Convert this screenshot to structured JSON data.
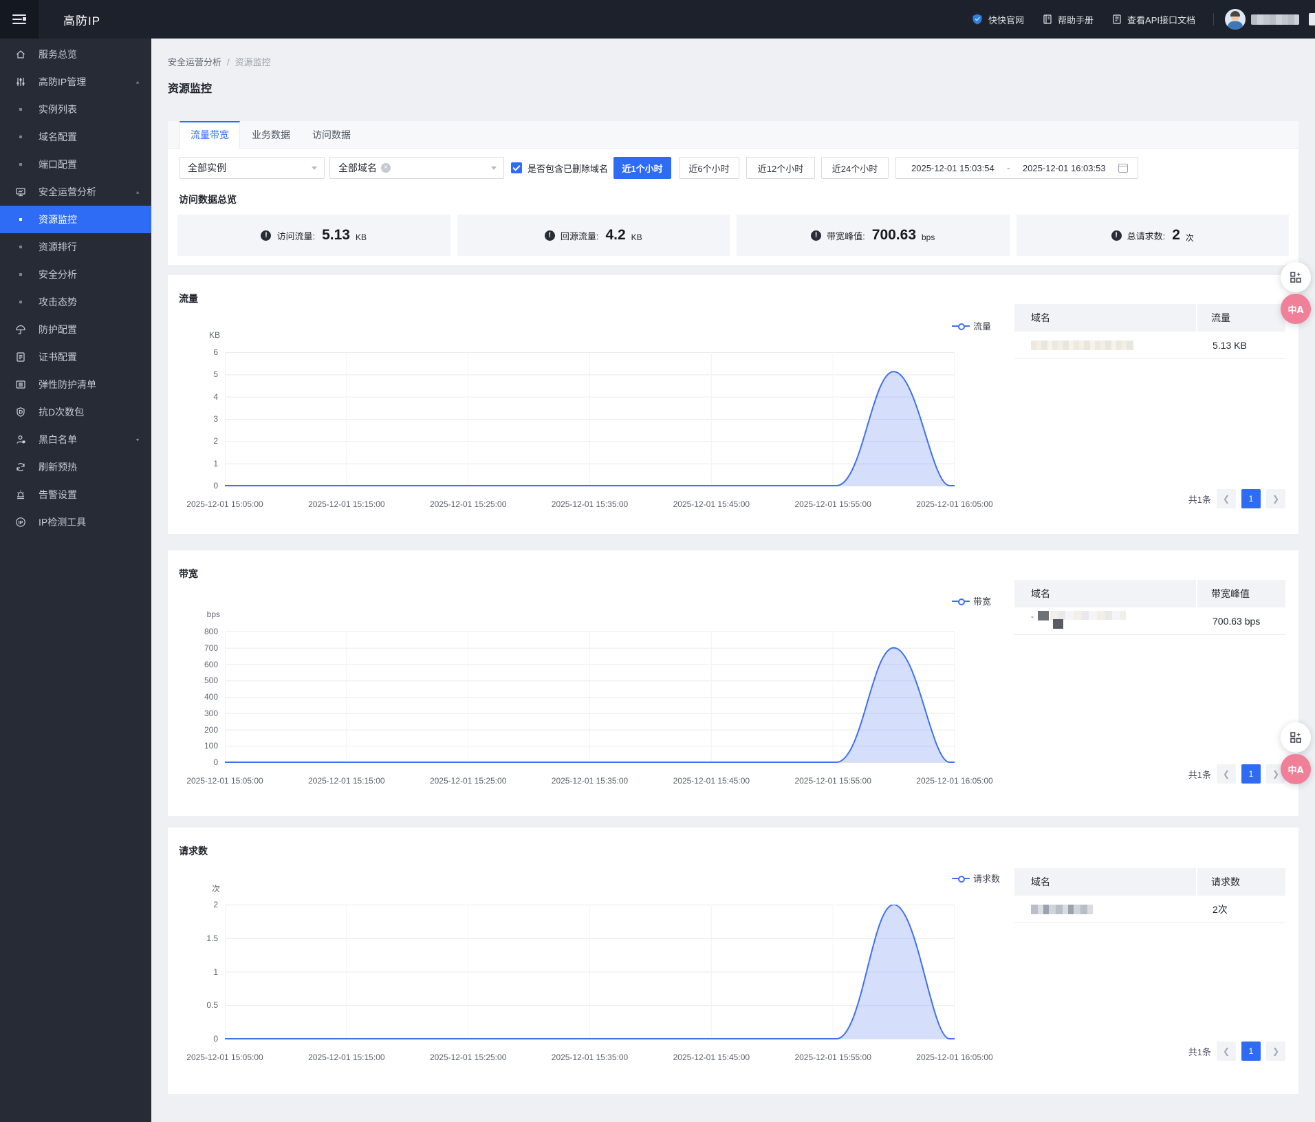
{
  "header": {
    "title": "高防IP",
    "nav": [
      {
        "key": "official-site",
        "label": "快快官网",
        "icon": "shield-logo"
      },
      {
        "key": "help-manual",
        "label": "帮助手册",
        "icon": "book"
      },
      {
        "key": "api-doc",
        "label": "查看API接口文档",
        "icon": "api-doc"
      }
    ],
    "user_name_redacted": true
  },
  "sidebar": {
    "items": [
      {
        "key": "service-overview",
        "label": "服务总览",
        "type": "top",
        "icon": "home"
      },
      {
        "key": "ip-manage",
        "label": "高防IP管理",
        "type": "top",
        "icon": "sliders",
        "arrow": "up"
      },
      {
        "key": "instance-list",
        "label": "实例列表",
        "type": "sub"
      },
      {
        "key": "domain-config",
        "label": "域名配置",
        "type": "sub"
      },
      {
        "key": "port-config",
        "label": "端口配置",
        "type": "sub"
      },
      {
        "key": "security-analysis-group",
        "label": "安全运营分析",
        "type": "top",
        "icon": "monitor",
        "arrow": "up"
      },
      {
        "key": "resource-monitor",
        "label": "资源监控",
        "type": "sub",
        "active": true
      },
      {
        "key": "resource-rank",
        "label": "资源排行",
        "type": "sub"
      },
      {
        "key": "security-analysis",
        "label": "安全分析",
        "type": "sub"
      },
      {
        "key": "attack-trend",
        "label": "攻击态势",
        "type": "sub"
      },
      {
        "key": "protect-config",
        "label": "防护配置",
        "type": "top",
        "icon": "umbrella"
      },
      {
        "key": "cert-config",
        "label": "证书配置",
        "type": "top",
        "icon": "cert"
      },
      {
        "key": "elastic-protect-list",
        "label": "弹性防护清单",
        "type": "top",
        "icon": "list"
      },
      {
        "key": "antid-package",
        "label": "抗D次数包",
        "type": "top",
        "icon": "shield"
      },
      {
        "key": "black-white-list",
        "label": "黑白名单",
        "type": "top",
        "icon": "person",
        "arrow": "down"
      },
      {
        "key": "refresh-preheat",
        "label": "刷新预热",
        "type": "top",
        "icon": "refresh"
      },
      {
        "key": "alert-setting",
        "label": "告警设置",
        "type": "top",
        "icon": "alarm"
      },
      {
        "key": "ip-check-tool",
        "label": "IP检测工具",
        "type": "top",
        "icon": "ip"
      }
    ]
  },
  "breadcrumb": {
    "parent": "安全运营分析",
    "separator": "/",
    "current": "资源监控"
  },
  "page": {
    "title": "资源监控"
  },
  "tabs": [
    {
      "key": "traffic-bandwidth",
      "label": "流量带宽",
      "active": true
    },
    {
      "key": "business-data",
      "label": "业务数据",
      "active": false
    },
    {
      "key": "access-data",
      "label": "访问数据",
      "active": false
    }
  ],
  "filters": {
    "instance_select": "全部实例",
    "domain_select": "全部域名",
    "checkbox_label": "是否包含已删除域名",
    "checkbox_checked": true,
    "time_buttons": [
      {
        "label": "近1个小时",
        "active": true
      },
      {
        "label": "近6个小时",
        "active": false
      },
      {
        "label": "近12个小时",
        "active": false
      },
      {
        "label": "近24个小时",
        "active": false
      }
    ],
    "date_start": "2025-12-01 15:03:54",
    "date_end": "2025-12-01 16:03:53"
  },
  "overview": {
    "title": "访问数据总览",
    "stats": [
      {
        "label": "访问流量:",
        "value": "5.13",
        "unit": "KB"
      },
      {
        "label": "回源流量:",
        "value": "4.2",
        "unit": "KB"
      },
      {
        "label": "带宽峰值:",
        "value": "700.63",
        "unit": "bps"
      },
      {
        "label": "总请求数:",
        "value": "2",
        "unit": "次"
      }
    ]
  },
  "chart_data": [
    {
      "type": "area",
      "title": "流量",
      "legend": "流量",
      "ylabel_unit": "KB",
      "ylim": [
        0,
        6
      ],
      "yticks": [
        0,
        1,
        2,
        3,
        4,
        5,
        6
      ],
      "x": [
        "15:05",
        "15:10",
        "15:15",
        "15:20",
        "15:25",
        "15:30",
        "15:35",
        "15:40",
        "15:45",
        "15:50",
        "15:55",
        "16:00",
        "16:05"
      ],
      "values": [
        0,
        0,
        0,
        0,
        0,
        0,
        0,
        0,
        0,
        0,
        0,
        5.13,
        0
      ],
      "xtick_labels": [
        "2025-12-01 15:05:00",
        "2025-12-01 15:15:00",
        "2025-12-01 15:25:00",
        "2025-12-01 15:35:00",
        "2025-12-01 15:45:00",
        "2025-12-01 15:55:00",
        "2025-12-01 16:05:00"
      ],
      "grid": true,
      "legend_position": "top-right",
      "table": {
        "domain_header": "域名",
        "value_header": "流量",
        "rows": [
          {
            "domain_redacted": true,
            "value": "5.13 KB"
          }
        ],
        "blur_style": "light"
      },
      "pagination": {
        "total_label": "共1条",
        "page": "1"
      }
    },
    {
      "type": "area",
      "title": "带宽",
      "legend": "带宽",
      "ylabel_unit": "bps",
      "ylim": [
        0,
        800
      ],
      "yticks": [
        0,
        100,
        200,
        300,
        400,
        500,
        600,
        700,
        800
      ],
      "x": [
        "15:05",
        "15:10",
        "15:15",
        "15:20",
        "15:25",
        "15:30",
        "15:35",
        "15:40",
        "15:45",
        "15:50",
        "15:55",
        "16:00",
        "16:05"
      ],
      "values": [
        0,
        0,
        0,
        0,
        0,
        0,
        0,
        0,
        0,
        0,
        0,
        700.63,
        0
      ],
      "xtick_labels": [
        "2025-12-01 15:05:00",
        "2025-12-01 15:15:00",
        "2025-12-01 15:25:00",
        "2025-12-01 15:35:00",
        "2025-12-01 15:45:00",
        "2025-12-01 15:55:00",
        "2025-12-01 16:05:00"
      ],
      "grid": true,
      "legend_position": "top-right",
      "table": {
        "domain_header": "域名",
        "value_header": "带宽峰值",
        "rows": [
          {
            "domain_redacted": true,
            "value": "700.63 bps"
          }
        ],
        "blur_style": "dark"
      },
      "pagination": {
        "total_label": "共1条",
        "page": "1"
      }
    },
    {
      "type": "area",
      "title": "请求数",
      "legend": "请求数",
      "ylabel_unit": "次",
      "ylim": [
        0,
        2
      ],
      "yticks": [
        0,
        0.5,
        1,
        1.5,
        2
      ],
      "x": [
        "15:05",
        "15:10",
        "15:15",
        "15:20",
        "15:25",
        "15:30",
        "15:35",
        "15:40",
        "15:45",
        "15:50",
        "15:55",
        "16:00",
        "16:05"
      ],
      "values": [
        0,
        0,
        0,
        0,
        0,
        0,
        0,
        0,
        0,
        0,
        0,
        2,
        0
      ],
      "xtick_labels": [
        "2025-12-01 15:05:00",
        "2025-12-01 15:15:00",
        "2025-12-01 15:25:00",
        "2025-12-01 15:35:00",
        "2025-12-01 15:45:00",
        "2025-12-01 15:55:00",
        "2025-12-01 16:05:00"
      ],
      "grid": true,
      "legend_position": "top-right",
      "table": {
        "domain_header": "域名",
        "value_header": "请求数",
        "rows": [
          {
            "domain_redacted": true,
            "value": "2次"
          }
        ],
        "blur_style": "multi"
      },
      "pagination": {
        "total_label": "共1条",
        "page": "1"
      }
    }
  ],
  "colors": {
    "accent": "#2f6cf6",
    "chart_line": "#3f6ff2",
    "sidebar_bg": "#262b36",
    "header_bg": "#1c212b"
  }
}
